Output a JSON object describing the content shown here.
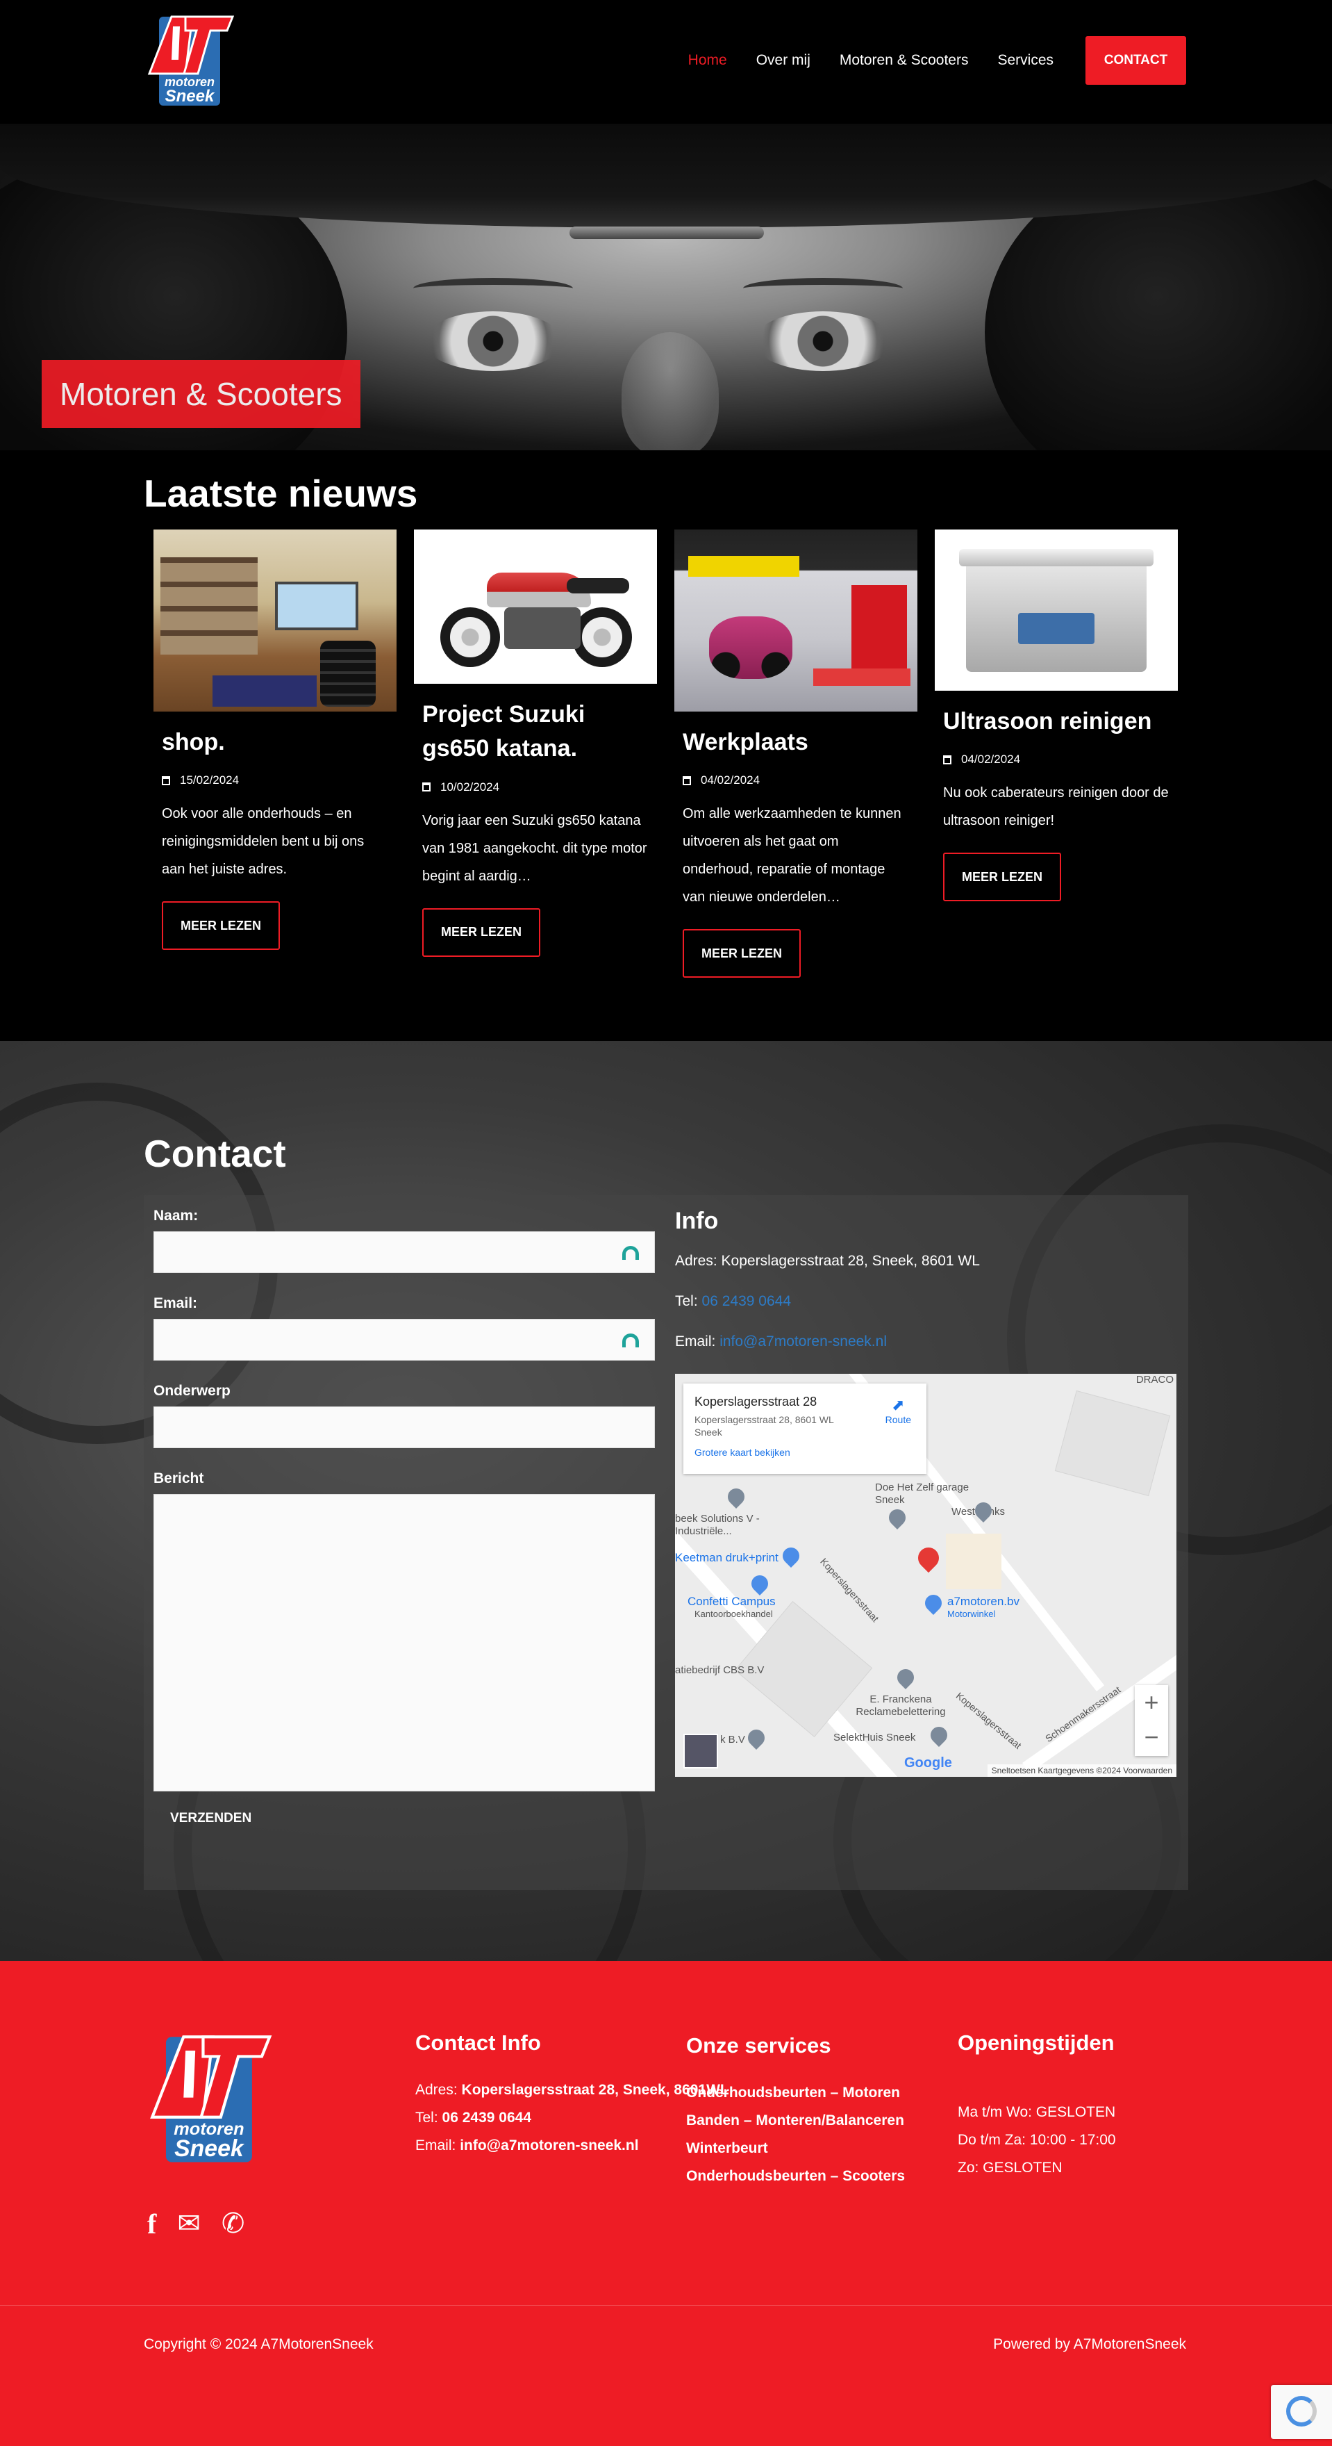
{
  "nav": {
    "items": [
      "Home",
      "Over mij",
      "Motoren & Scooters",
      "Services"
    ],
    "contact": "CONTACT"
  },
  "logo": {
    "top": "motoren",
    "bottom": "Sneek",
    "mark": "A7"
  },
  "hero": {
    "label": "Motoren & Scooters"
  },
  "news": {
    "title": "Laatste nieuws",
    "cards": [
      {
        "title": "shop.",
        "date": "15/02/2024",
        "text": "Ook voor alle onderhouds – en reinigingsmiddelen bent u bij ons aan het juiste adres.",
        "button": "MEER LEZEN"
      },
      {
        "title": "Project Suzuki gs650 katana.",
        "date": "10/02/2024",
        "text": "Vorig jaar een Suzuki gs650 katana van 1981 aangekocht. dit type motor begint al aardig…",
        "button": "MEER LEZEN"
      },
      {
        "title": "Werkplaats",
        "date": "04/02/2024",
        "text": "Om alle werkzaamheden te kunnen uitvoeren als het gaat om onderhoud, reparatie of montage van nieuwe onderdelen…",
        "button": "MEER LEZEN"
      },
      {
        "title": "Ultrasoon reinigen",
        "date": "04/02/2024",
        "text": "Nu ook caberateurs reinigen door de ultrasoon reiniger!",
        "button": "MEER LEZEN"
      }
    ]
  },
  "contact": {
    "title": "Contact",
    "form": {
      "name_label": "Naam:",
      "email_label": "Email:",
      "subject_label": "Onderwerp",
      "message_label": "Bericht",
      "submit": "VERZENDEN"
    },
    "info": {
      "title": "Info",
      "address": "Adres: Koperslagersstraat 28, Sneek, 8601 WL",
      "tel_label": "Tel:",
      "tel": "06 2439 0644",
      "email_label": "Email:",
      "email": "info@a7motoren-sneek.nl"
    },
    "map": {
      "card_title": "Koperslagersstraat 28",
      "card_address": "Koperslagersstraat 28, 8601 WL Sneek",
      "card_link": "Grotere kaart bekijken",
      "route": "Route",
      "labels": [
        "DRACO",
        "Doe Het Zelf garage Sneek",
        "West Tanks",
        "beek Solutions V - Industriële...",
        "Keetman druk+print",
        "Confetti Campus",
        "Kantoorboekhandel",
        "a7motoren.bv",
        "Motorwinkel",
        "Koperslagersstraat",
        "atiebedrijf CBS B.V",
        "E. Franckena Reclamebelettering",
        "SelektHuis Sneek",
        "Koperslagersstraat",
        "Schoenmakersstraat",
        "k B.V"
      ],
      "footer": "Sneltoetsen   Kaartgegevens ©2024   Voorwaarden",
      "zoom_in": "+",
      "zoom_out": "−",
      "google": "Google"
    }
  },
  "footer": {
    "contact_title": "Contact Info",
    "address_label": "Adres:",
    "address": "Koperslagersstraat 28, Sneek, 8601WL",
    "tel_label": "Tel:",
    "tel": "06 2439 0644",
    "email_label": "Email:",
    "email": "info@a7motoren-sneek.nl",
    "services_title": "Onze services",
    "services": [
      "Onderhoudsbeurten – Motoren",
      "Banden – Monteren/Balanceren",
      "Winterbeurt",
      "Onderhoudsbeurten – Scooters"
    ],
    "hours_title": "Openingstijden",
    "hours": [
      "Ma t/m Wo: GESLOTEN",
      "Do t/m Za: 10:00 - 17:00",
      "Zo: GESLOTEN"
    ],
    "copyright": "Copyright © 2024 A7MotorenSneek",
    "powered": "Powered by A7MotorenSneek"
  },
  "colors": {
    "accent": "#ee1c25",
    "link": "#2d7bc6"
  }
}
